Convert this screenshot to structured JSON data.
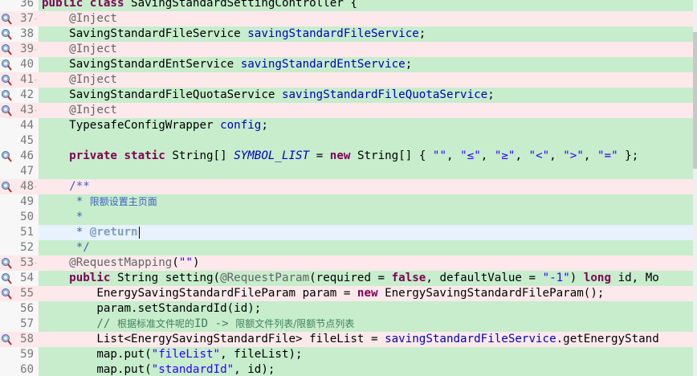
{
  "editor": {
    "title": "SavingStandardSettingController",
    "lines": [
      {
        "n": "36",
        "marker": "",
        "bg": "green",
        "tokens": [
          {
            "t": "kw",
            "v": "public "
          },
          {
            "t": "kw",
            "v": "class "
          },
          {
            "t": "",
            "v": "SavingStandardSettingController {"
          }
        ]
      },
      {
        "n": "37",
        "marker": "bookmark",
        "bg": "pink",
        "fold": "-",
        "tokens": [
          {
            "t": "",
            "v": "    "
          },
          {
            "t": "ann",
            "v": "@Inject"
          }
        ]
      },
      {
        "n": "38",
        "marker": "bookmark",
        "bg": "green",
        "tokens": [
          {
            "t": "",
            "v": "    SavingStandardFileService "
          },
          {
            "t": "fld",
            "v": "savingStandardFileService"
          },
          {
            "t": "",
            "v": ";"
          }
        ]
      },
      {
        "n": "39",
        "marker": "bookmark",
        "bg": "pink",
        "fold": "-",
        "tokens": [
          {
            "t": "",
            "v": "    "
          },
          {
            "t": "ann",
            "v": "@Inject"
          }
        ]
      },
      {
        "n": "40",
        "marker": "bookmark",
        "bg": "green",
        "tokens": [
          {
            "t": "",
            "v": "    SavingStandardEntService "
          },
          {
            "t": "fld",
            "v": "savingStandardEntService"
          },
          {
            "t": "",
            "v": ";"
          }
        ]
      },
      {
        "n": "41",
        "marker": "bookmark",
        "bg": "pink",
        "fold": "-",
        "tokens": [
          {
            "t": "",
            "v": "    "
          },
          {
            "t": "ann",
            "v": "@Inject"
          }
        ]
      },
      {
        "n": "42",
        "marker": "bookmark",
        "bg": "green",
        "tokens": [
          {
            "t": "",
            "v": "    SavingStandardFileQuotaService "
          },
          {
            "t": "fld",
            "v": "savingStandardFileQuotaService"
          },
          {
            "t": "",
            "v": ";"
          }
        ]
      },
      {
        "n": "43",
        "marker": "bookmark",
        "bg": "pink",
        "fold": "-",
        "tokens": [
          {
            "t": "",
            "v": "    "
          },
          {
            "t": "ann",
            "v": "@Inject"
          }
        ]
      },
      {
        "n": "44",
        "marker": "",
        "bg": "green",
        "tokens": [
          {
            "t": "",
            "v": "    TypesafeConfigWrapper "
          },
          {
            "t": "fld",
            "v": "config"
          },
          {
            "t": "",
            "v": ";"
          }
        ]
      },
      {
        "n": "45",
        "marker": "",
        "bg": "green",
        "tokens": []
      },
      {
        "n": "46",
        "marker": "bookmark",
        "bg": "green",
        "tokens": [
          {
            "t": "",
            "v": "    "
          },
          {
            "t": "kw",
            "v": "private "
          },
          {
            "t": "kw",
            "v": "static "
          },
          {
            "t": "",
            "v": "String[] "
          },
          {
            "t": "sfld",
            "v": "SYMBOL_LIST"
          },
          {
            "t": "",
            "v": " = "
          },
          {
            "t": "kw",
            "v": "new "
          },
          {
            "t": "",
            "v": "String[] { "
          },
          {
            "t": "str",
            "v": "\"\""
          },
          {
            "t": "",
            "v": ", "
          },
          {
            "t": "str",
            "v": "\"≤\""
          },
          {
            "t": "",
            "v": ", "
          },
          {
            "t": "str",
            "v": "\"≥\""
          },
          {
            "t": "",
            "v": ", "
          },
          {
            "t": "str",
            "v": "\"<\""
          },
          {
            "t": "",
            "v": ", "
          },
          {
            "t": "str",
            "v": "\">\""
          },
          {
            "t": "",
            "v": ", "
          },
          {
            "t": "str",
            "v": "\"=\""
          },
          {
            "t": "",
            "v": " };"
          }
        ]
      },
      {
        "n": "47",
        "marker": "",
        "bg": "green",
        "tokens": []
      },
      {
        "n": "48",
        "marker": "bookmark",
        "bg": "pink",
        "fold": "-",
        "tokens": [
          {
            "t": "",
            "v": "    "
          },
          {
            "t": "cmt",
            "v": "/**"
          }
        ]
      },
      {
        "n": "49",
        "marker": "",
        "bg": "green",
        "tokens": [
          {
            "t": "cmt",
            "v": "     * "
          },
          {
            "t": "cmt cmt-cjk",
            "v": "限额设置主页面"
          }
        ]
      },
      {
        "n": "50",
        "marker": "",
        "bg": "green",
        "tokens": [
          {
            "t": "cmt",
            "v": "     *"
          }
        ]
      },
      {
        "n": "51",
        "marker": "",
        "bg": "current",
        "caret": true,
        "tokens": [
          {
            "t": "cmt",
            "v": "     * "
          },
          {
            "t": "tag",
            "v": "@return"
          }
        ]
      },
      {
        "n": "52",
        "marker": "",
        "bg": "green",
        "tokens": [
          {
            "t": "cmt",
            "v": "     */"
          }
        ]
      },
      {
        "n": "53",
        "marker": "bookmark",
        "bg": "pink",
        "fold": "-",
        "tokens": [
          {
            "t": "",
            "v": "    "
          },
          {
            "t": "ann",
            "v": "@RequestMapping"
          },
          {
            "t": "",
            "v": "("
          },
          {
            "t": "str",
            "v": "\"\""
          },
          {
            "t": "",
            "v": ")"
          }
        ]
      },
      {
        "n": "54",
        "marker": "bookmark",
        "bg": "green",
        "tokens": [
          {
            "t": "",
            "v": "    "
          },
          {
            "t": "kw",
            "v": "public "
          },
          {
            "t": "",
            "v": "String setting("
          },
          {
            "t": "ann",
            "v": "@RequestParam"
          },
          {
            "t": "",
            "v": "(required = "
          },
          {
            "t": "kw",
            "v": "false"
          },
          {
            "t": "",
            "v": ", defaultValue = "
          },
          {
            "t": "str",
            "v": "\"-1\""
          },
          {
            "t": "",
            "v": ") "
          },
          {
            "t": "kw",
            "v": "long "
          },
          {
            "t": "",
            "v": "id, Mo"
          }
        ]
      },
      {
        "n": "55",
        "marker": "bookmark",
        "bg": "pink",
        "tokens": [
          {
            "t": "",
            "v": "        EnergySavingStandardFileParam param = "
          },
          {
            "t": "kw",
            "v": "new "
          },
          {
            "t": "",
            "v": "EnergySavingStandardFileParam();"
          }
        ]
      },
      {
        "n": "56",
        "marker": "",
        "bg": "green",
        "tokens": [
          {
            "t": "",
            "v": "        param.setStandardId(id);"
          }
        ]
      },
      {
        "n": "57",
        "marker": "",
        "bg": "green",
        "tokens": [
          {
            "t": "lcmt",
            "v": "        // "
          },
          {
            "t": "lcmt cmt-cjk",
            "v": "根据标准文件呢的"
          },
          {
            "t": "lcmt",
            "v": "ID -> "
          },
          {
            "t": "lcmt cmt-cjk",
            "v": "限额文件列表/限额节点列表"
          }
        ]
      },
      {
        "n": "58",
        "marker": "bookmark",
        "bg": "pink",
        "tokens": [
          {
            "t": "",
            "v": "        List<EnergySavingStandardFile> fileList = "
          },
          {
            "t": "fld",
            "v": "savingStandardFileService"
          },
          {
            "t": "",
            "v": ".getEnergyStand"
          }
        ]
      },
      {
        "n": "59",
        "marker": "",
        "bg": "green",
        "tokens": [
          {
            "t": "",
            "v": "        map.put("
          },
          {
            "t": "str",
            "v": "\"fileList\""
          },
          {
            "t": "",
            "v": ", fileList);"
          }
        ]
      },
      {
        "n": "60",
        "marker": "",
        "bg": "green",
        "tokens": [
          {
            "t": "",
            "v": "        map.put("
          },
          {
            "t": "str",
            "v": "\"standardId\""
          },
          {
            "t": "",
            "v": ", id);"
          }
        ]
      }
    ]
  },
  "colors": {
    "keyword": "#7f0055",
    "string": "#2a00ff",
    "field": "#0000c0",
    "javadoc": "#3f5fbf",
    "line_comment": "#3f7f5f",
    "annotation": "#646464",
    "pink_highlight": "#fde9ec",
    "green_highlight": "#c7edcc",
    "current_line": "#e8f2fe"
  }
}
